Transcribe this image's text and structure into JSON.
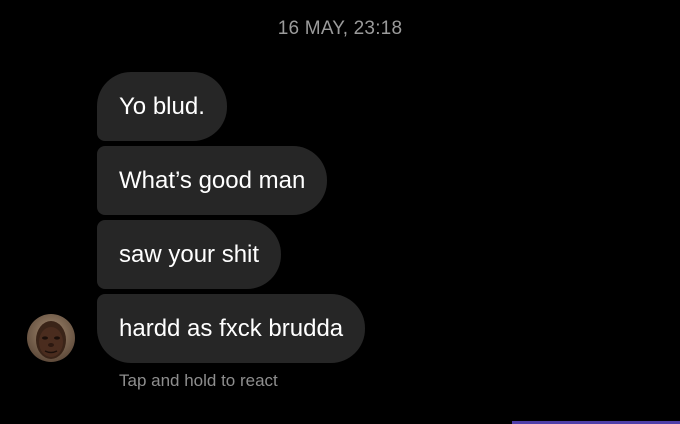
{
  "thread": {
    "timestamp": "16 MAY, 23:18",
    "messages": [
      "Yo blud.",
      "What’s good man",
      "saw your shit",
      "hardd as fxck brudda"
    ],
    "react_hint": "Tap and hold to react"
  },
  "colors": {
    "background": "#000000",
    "bubble": "#262626",
    "bubble_text": "#ffffff",
    "meta_text": "#9b9b9b",
    "accent": "#4f3fa8"
  },
  "icons": {
    "avatar": "sender-avatar-photo"
  }
}
